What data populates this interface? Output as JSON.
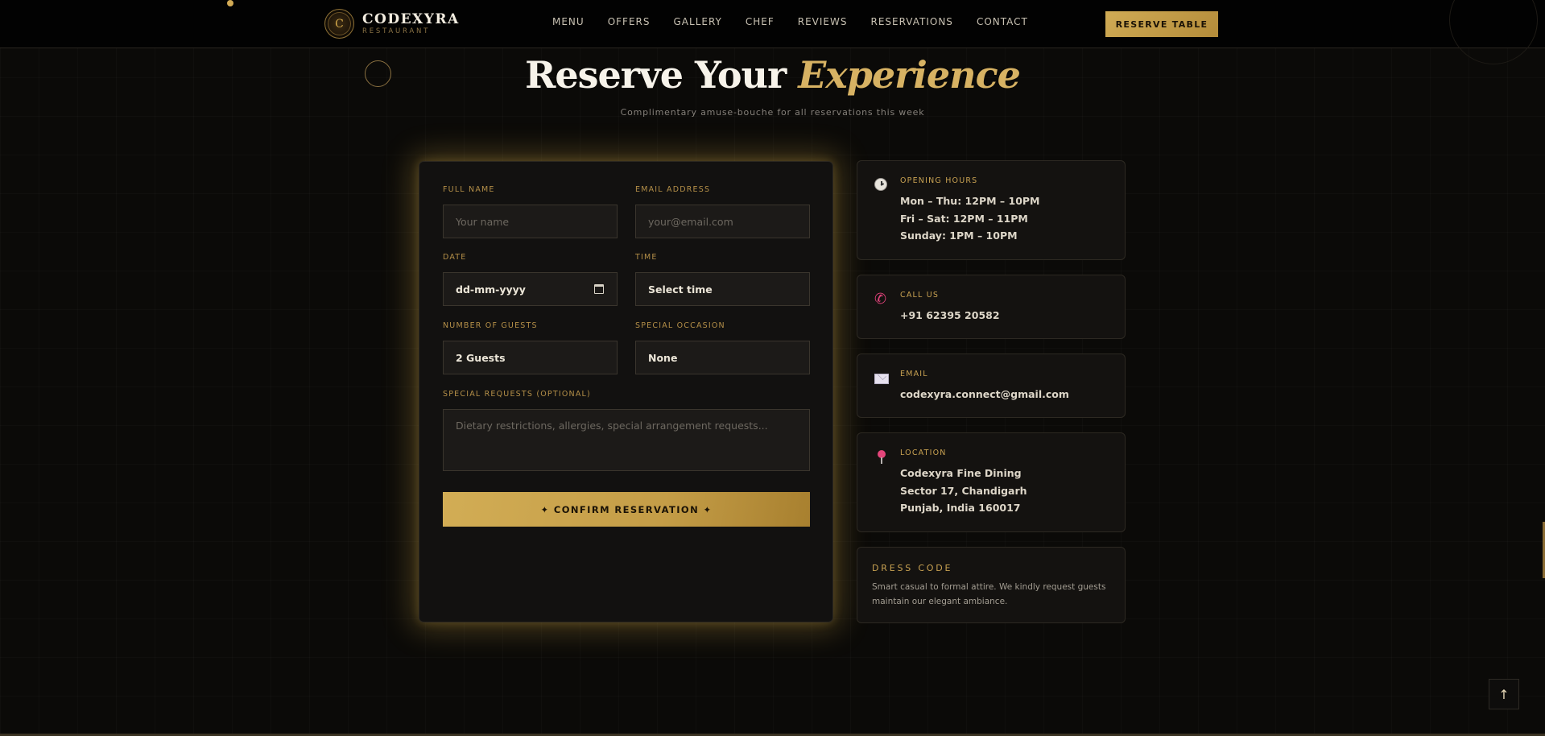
{
  "nav": {
    "logo_mark": "C",
    "brand_name": "CODEXYRA",
    "brand_sub": "RESTAURANT",
    "links": [
      "MENU",
      "OFFERS",
      "GALLERY",
      "CHEF",
      "REVIEWS",
      "RESERVATIONS",
      "CONTACT"
    ],
    "cta": "RESERVE TABLE"
  },
  "hero": {
    "title_main": "Reserve Your ",
    "title_accent": "Experience",
    "subtitle": "Complimentary amuse-bouche for all reservations this week"
  },
  "form": {
    "full_name": {
      "label": "FULL NAME",
      "placeholder": "Your name"
    },
    "email": {
      "label": "EMAIL ADDRESS",
      "placeholder": "your@email.com"
    },
    "date": {
      "label": "DATE",
      "value": "dd-mm-yyyy"
    },
    "time": {
      "label": "TIME",
      "value": "Select time"
    },
    "guests": {
      "label": "NUMBER OF GUESTS",
      "value": "2 Guests"
    },
    "occasion": {
      "label": "SPECIAL OCCASION",
      "value": "None"
    },
    "requests": {
      "label": "SPECIAL REQUESTS (OPTIONAL)",
      "placeholder": "Dietary restrictions, allergies, special arrangement requests..."
    },
    "submit": "✦ CONFIRM RESERVATION ✦"
  },
  "info": {
    "hours": {
      "title": "OPENING HOURS",
      "lines": [
        "Mon – Thu: 12PM – 10PM",
        "Fri – Sat: 12PM – 11PM",
        "Sunday: 1PM – 10PM"
      ],
      "icon": "clock-icon"
    },
    "phone": {
      "title": "CALL US",
      "value": "+91 62395 20582",
      "icon": "phone-icon"
    },
    "email": {
      "title": "EMAIL",
      "value": "codexyra.connect@gmail.com",
      "icon": "envelope-icon"
    },
    "location": {
      "title": "LOCATION",
      "lines": [
        "Codexyra Fine Dining",
        "Sector 17, Chandigarh",
        "Punjab, India 160017"
      ],
      "icon": "pin-icon"
    },
    "dress_code": {
      "title": "DRESS CODE",
      "text": "Smart casual to formal attire. We kindly request guests maintain our elegant ambiance."
    }
  },
  "scroll_top": "↑",
  "colors": {
    "gold": "#d2ad55",
    "background": "#0b0a08",
    "card": "#121110",
    "pink": "#e0427a"
  }
}
